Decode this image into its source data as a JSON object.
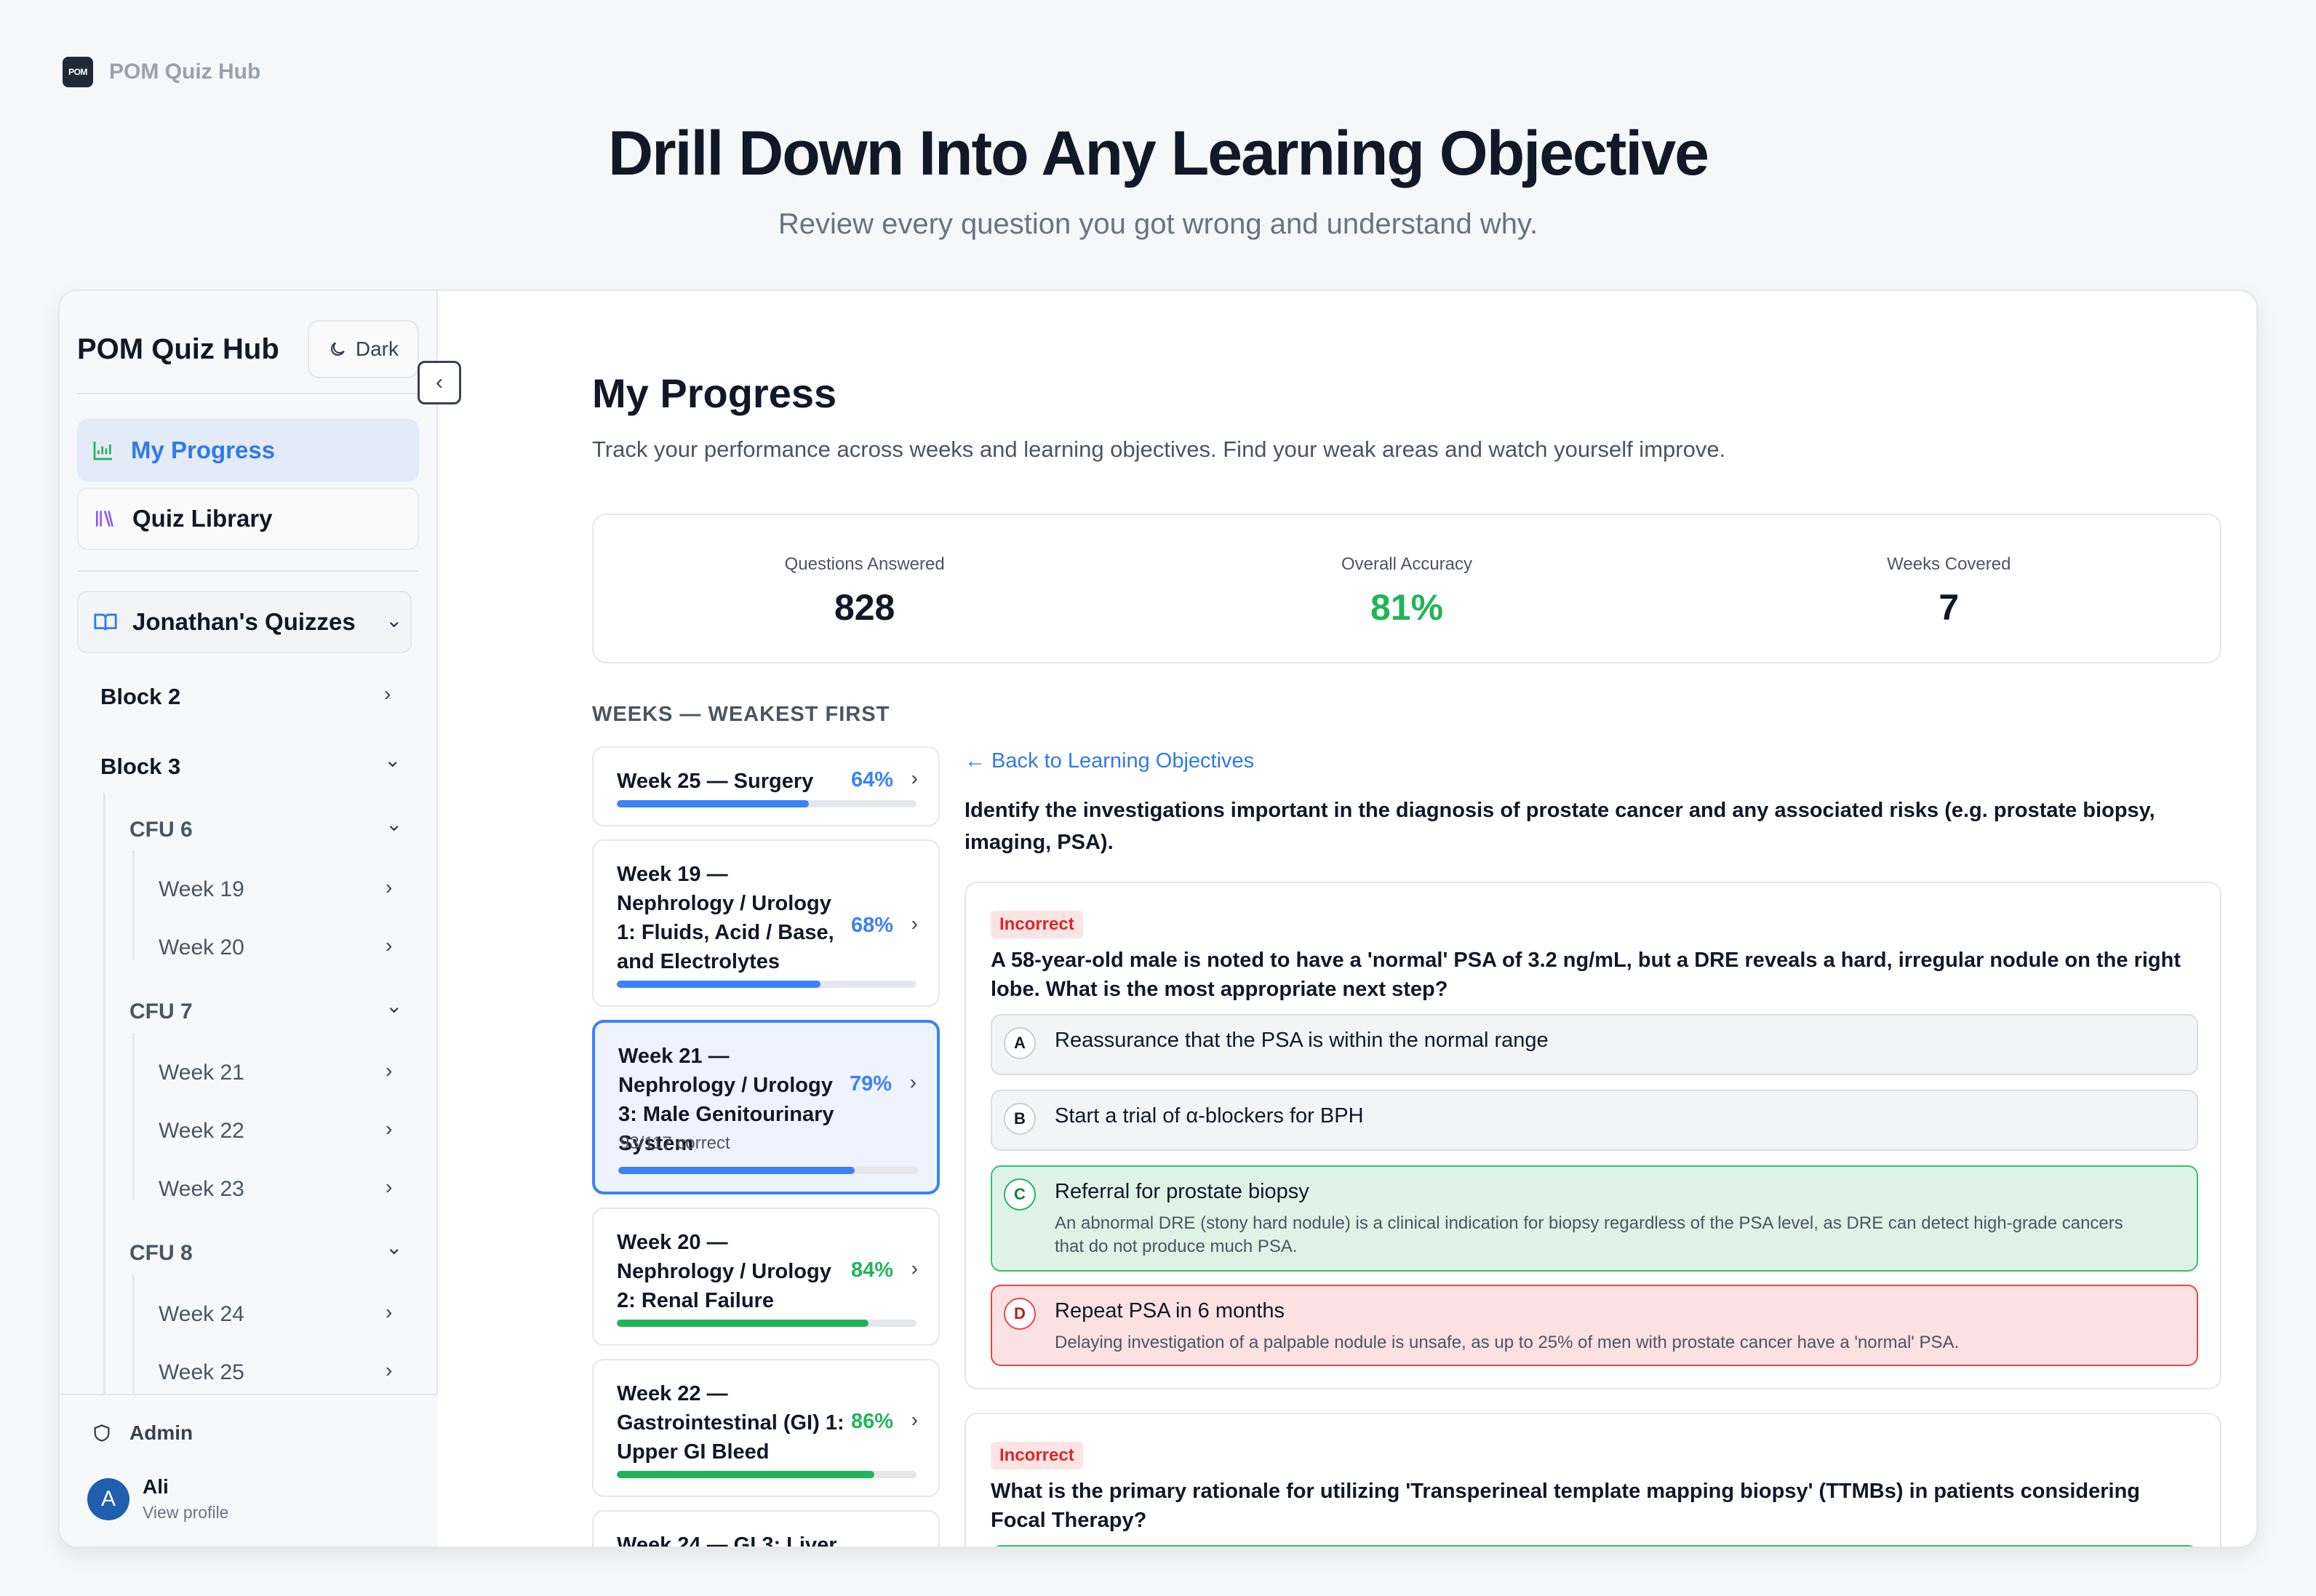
{
  "brand": {
    "logo_text": "POM",
    "name": "POM Quiz Hub"
  },
  "hero": {
    "title": "Drill Down Into Any Learning Objective",
    "subtitle": "Review every question you got wrong and understand why."
  },
  "sidebar": {
    "title": "POM Quiz Hub",
    "dark_label": "Dark",
    "nav": [
      {
        "label": "My Progress",
        "icon": "bar-chart-icon"
      },
      {
        "label": "Quiz Library",
        "icon": "library-icon"
      }
    ],
    "quiz_group": "Jonathan's Quizzes",
    "tree": {
      "block2": "Block 2",
      "block3": "Block 3",
      "cfu6": "CFU 6",
      "cfu7": "CFU 7",
      "cfu8": "CFU 8",
      "weeks": [
        "Week 19",
        "Week 20",
        "Week 21",
        "Week 22",
        "Week 23",
        "Week 24",
        "Week 25"
      ]
    },
    "admin": "Admin",
    "user": {
      "initial": "A",
      "name": "Ali",
      "sub": "View profile"
    }
  },
  "main": {
    "title": "My Progress",
    "description": "Track your performance across weeks and learning objectives. Find your weak areas and watch yourself improve.",
    "stats": [
      {
        "label": "Questions Answered",
        "value": "828"
      },
      {
        "label": "Overall Accuracy",
        "value": "81%"
      },
      {
        "label": "Weeks Covered",
        "value": "7"
      }
    ],
    "weeks_heading": "WEEKS — WEAKEST FIRST",
    "weeks": [
      {
        "name": "Week 25 — Surgery",
        "pct": "64%",
        "progress": 0.64
      },
      {
        "name": "Week 19 — Nephrology / Urology 1: Fluids, Acid / Base, and Electrolytes",
        "pct": "68%",
        "progress": 0.68
      },
      {
        "name": "Week 21 — Nephrology / Urology 3: Male Genitourinary System",
        "pct": "79%",
        "progress": 0.79,
        "sub": "93/117 correct"
      },
      {
        "name": "Week 20 — Nephrology / Urology 2: Renal Failure",
        "pct": "84%",
        "progress": 0.84
      },
      {
        "name": "Week 22 — Gastrointestinal (GI) 1: Upper GI Bleed",
        "pct": "86%",
        "progress": 0.86
      },
      {
        "name": "Week 24 — GI 3: Liver"
      }
    ],
    "back_link": "← Back to Learning Objectives",
    "objective": "Identify the investigations important in the diagnosis of prostate cancer and any associated risks (e.g. prostate biopsy, imaging, PSA).",
    "questions": [
      {
        "badge": "Incorrect",
        "text": "A 58-year-old male is noted to have a 'normal' PSA of 3.2 ng/mL, but a DRE reveals a hard, irregular nodule on the right lobe. What is the most appropriate next step?",
        "options": [
          {
            "letter": "A",
            "text": "Reassurance that the PSA is within the normal range"
          },
          {
            "letter": "B",
            "text": "Start a trial of α-blockers for BPH"
          },
          {
            "letter": "C",
            "text": "Referral for prostate biopsy",
            "explanation": "An abnormal DRE (stony hard nodule) is a clinical indication for biopsy regardless of the PSA level, as DRE can detect high-grade cancers that do not produce much PSA."
          },
          {
            "letter": "D",
            "text": "Repeat PSA in 6 months",
            "explanation": "Delaying investigation of a palpable nodule is unsafe, as up to 25% of men with prostate cancer have a 'normal' PSA."
          }
        ]
      },
      {
        "badge": "Incorrect",
        "text": "What is the primary rationale for utilizing 'Transperineal template mapping biopsy' (TTMBs) in patients considering Focal Therapy?"
      }
    ]
  },
  "colors": {
    "accent": "#2f7be6",
    "green": "#22b45b",
    "red": "#ef4444"
  }
}
